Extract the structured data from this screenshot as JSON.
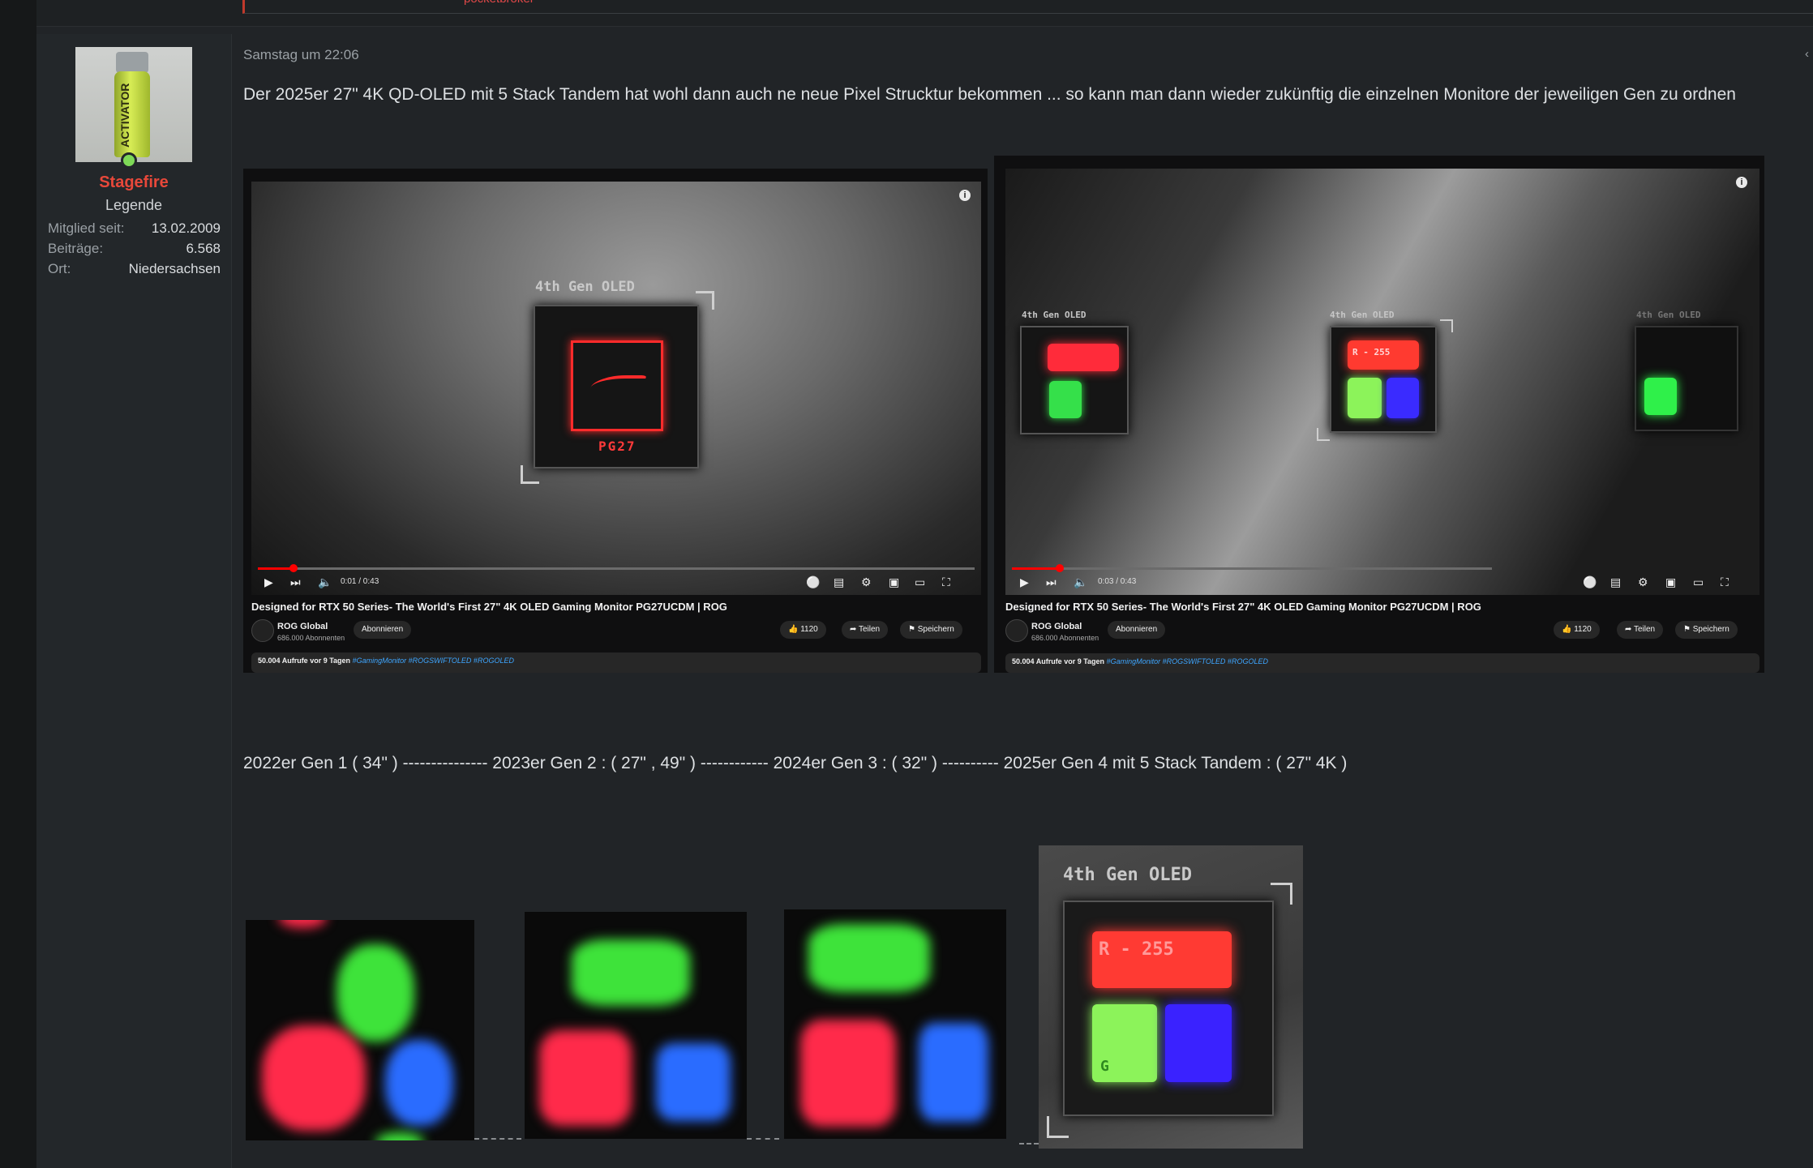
{
  "prev": {
    "link_text": "pocketbroker"
  },
  "user": {
    "name": "Stagefire",
    "title": "Legende",
    "avatar_text": "ACTIVATOR",
    "stats": [
      {
        "label": "Mitglied seit:",
        "value": "13.02.2009"
      },
      {
        "label": "Beiträge:",
        "value": "6.568"
      },
      {
        "label": "Ort:",
        "value": "Niedersachsen"
      }
    ]
  },
  "post": {
    "date": "Samstag um 22:06",
    "text": "Der 2025er 27\" 4K QD-OLED mit 5 Stack Tandem hat wohl dann auch ne neue Pixel Strucktur bekommen ... so kann man dann wieder zukünftig die einzelnen Monitore der jeweiligen Gen zu ordnen",
    "gen_line": "2022er Gen 1 ( 34\" ) --------------- 2023er Gen 2 : ( 27\" , 49\" ) ------------ 2024er Gen 3 : ( 32\" ) ---------- 2025er Gen 4 mit 5 Stack Tandem : ( 27\" 4K )"
  },
  "videos": [
    {
      "panel_label": "4th Gen OLED",
      "model": "PG27",
      "time": "0:01 / 0:43",
      "title": "Designed for RTX 50 Series- The World's First 27\" 4K OLED Gaming Monitor PG27UCDM | ROG",
      "channel": "ROG Global",
      "subscribers": "686.000 Abonnenten",
      "subscribe": "Abonnieren",
      "likes": "1120",
      "share": "Teilen",
      "save": "Speichern",
      "views": "50.004 Aufrufe  vor 9 Tagen",
      "tags": "#GamingMonitor #ROGSWIFTOLED #ROGOLED",
      "progress": 0.05
    },
    {
      "panel_label_1": "4th Gen OLED",
      "panel_label_2": "4th Gen OLED",
      "panel_label_3": "4th Gen OLED",
      "red_label": "R - 255",
      "time": "0:03 / 0:43",
      "title": "Designed for RTX 50 Series- The World's First 27\" 4K OLED Gaming Monitor PG27UCDM | ROG",
      "channel": "ROG Global",
      "subscribers": "686.000 Abonnenten",
      "subscribe": "Abonnieren",
      "likes": "1120",
      "share": "Teilen",
      "save": "Speichern",
      "views": "50.004 Aufrufe  vor 9 Tagen",
      "tags": "#GamingMonitor #ROGSWIFTOLED #ROGOLED",
      "progress": 0.1
    }
  ],
  "gen4_crop": {
    "label": "4th Gen OLED",
    "red_label": "R - 255",
    "green_label": "G"
  },
  "colors": {
    "username": "#e8483a",
    "red_px": "#ff2b3a",
    "green_px": "#35e04a",
    "blue_px": "#2f6bff"
  }
}
